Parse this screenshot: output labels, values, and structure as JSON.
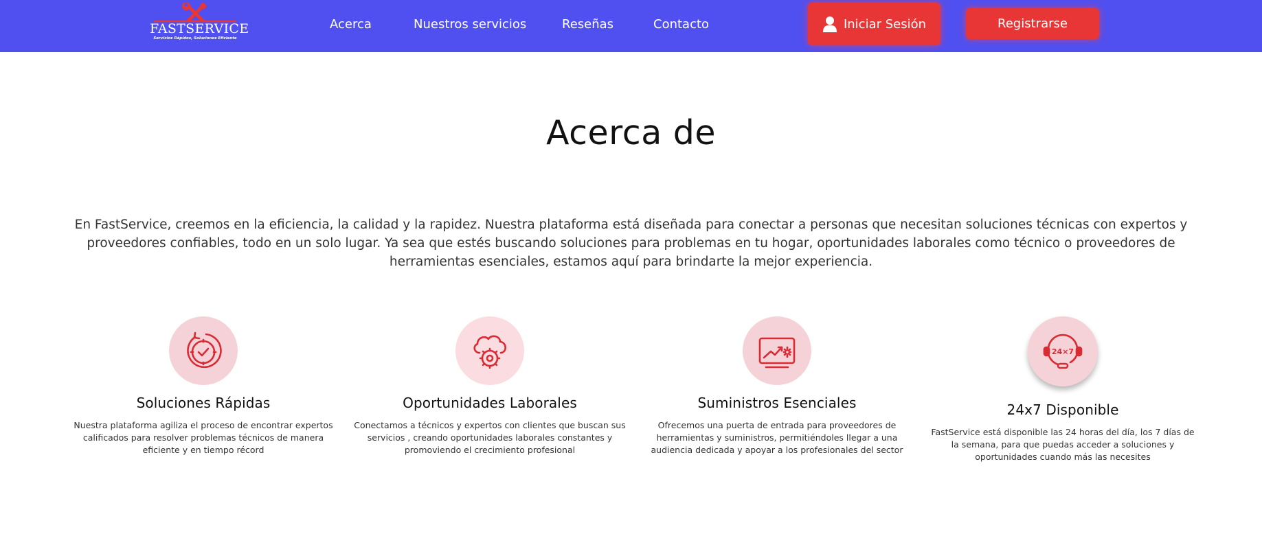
{
  "header": {
    "logo": {
      "name": "FASTSERVICE",
      "tagline": "Servicios Rápidos, Soluciones Eficiente"
    },
    "nav": [
      {
        "label": "Acerca"
      },
      {
        "label": "Nuestros servicios"
      },
      {
        "label": "Reseñas"
      },
      {
        "label": "Contacto"
      }
    ],
    "login_label": "Iniciar Sesión",
    "register_label": "Registrarse"
  },
  "about": {
    "title": "Acerca de",
    "intro": "En FastService, creemos en la eficiencia, la calidad y la rapidez. Nuestra plataforma está diseñada para conectar a personas que necesitan soluciones técnicas con expertos y proveedores confiables, todo en un solo lugar. Ya sea que estés buscando soluciones para problemas en tu hogar, oportunidades laborales como técnico o proveedores de herramientas esenciales, estamos aquí para brindarte la mejor experiencia.",
    "features": [
      {
        "title": "Soluciones Rápidas",
        "text": "Nuestra plataforma agiliza el proceso de encontrar expertos calificados para resolver problemas técnicos de manera eficiente y en tiempo récord",
        "icon": "fast-clock-check-icon"
      },
      {
        "title": "Oportunidades Laborales",
        "text": "Conectamos a técnicos y expertos con clientes que buscan sus servicios , creando oportunidades laborales constantes y promoviendo el crecimiento profesional",
        "icon": "cloud-gear-icon"
      },
      {
        "title": "Suministros Esenciales",
        "text": "Ofrecemos una puerta de entrada para proveedores de herramientas y suministros, permitiéndoles llegar a una audiencia dedicada y apoyar a los profesionales del sector",
        "icon": "growth-chart-screen-icon"
      },
      {
        "title": "24x7 Disponible",
        "text": "FastService está disponible las 24 horas del día, los 7 días de la semana, para que puedas acceder a soluciones y oportunidades cuando más las necesites",
        "icon": "headset-24x7-icon",
        "icon_text": "24×7"
      }
    ]
  },
  "colors": {
    "nav_bg": "#5050f0",
    "button_red": "#e83535",
    "icon_red": "#d92b33",
    "icon_circle": "#f4d2d8"
  }
}
